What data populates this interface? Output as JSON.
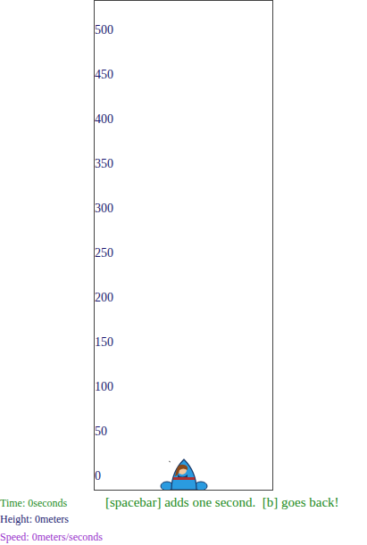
{
  "axis": {
    "ticks": [
      "500",
      "450",
      "400",
      "350",
      "300",
      "250",
      "200",
      "150",
      "100",
      "50",
      "0"
    ]
  },
  "rocket": {
    "level": 0
  },
  "stats": {
    "time": "Time: 0seconds",
    "height": "Height: 0meters",
    "speed": "Speed: 0meters/seconds"
  },
  "instructions": "[spacebar] adds one second.  [b] goes back!"
}
